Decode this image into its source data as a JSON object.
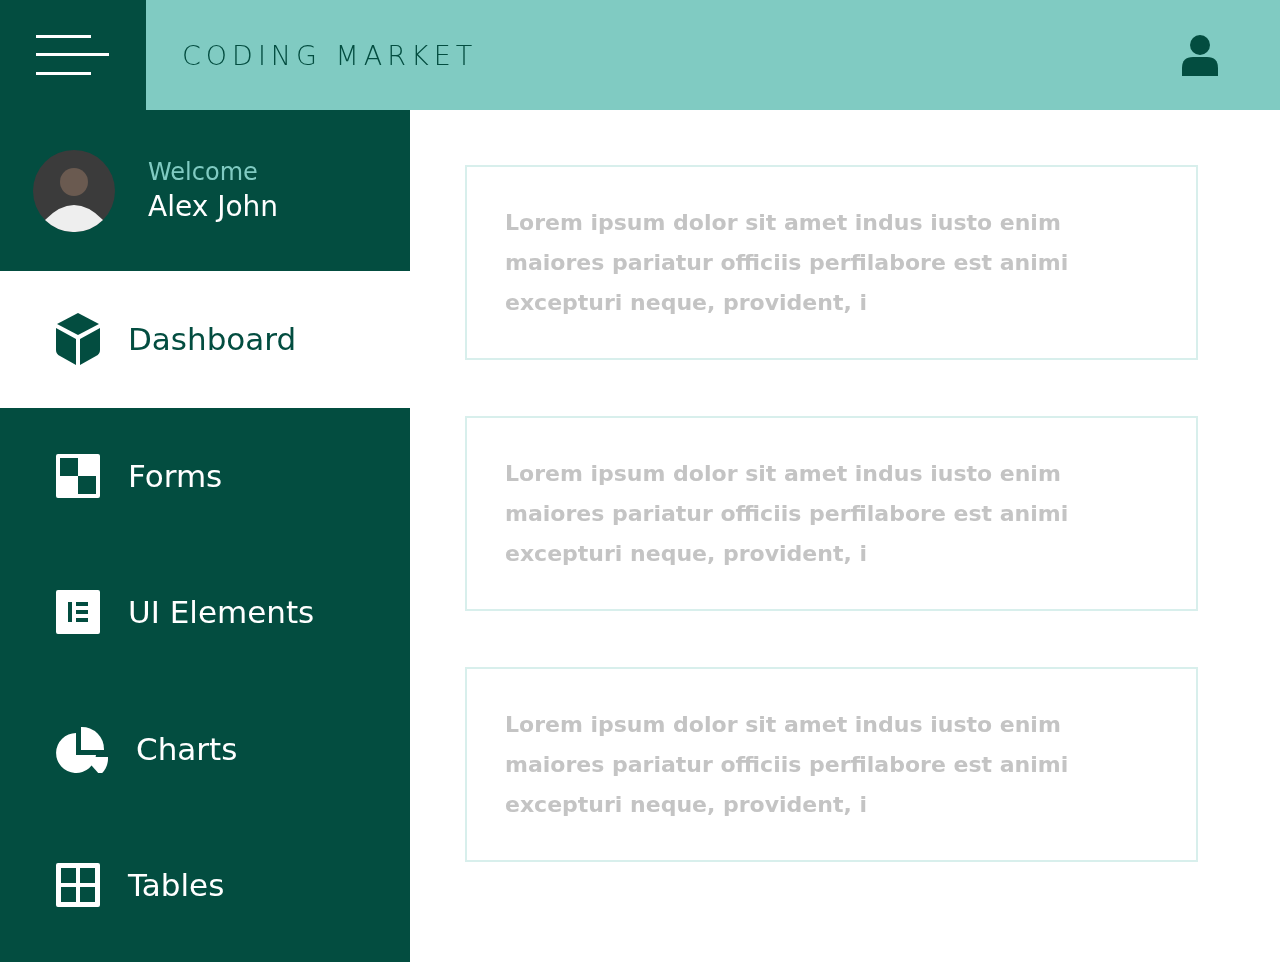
{
  "header": {
    "title": "CODING MARKET"
  },
  "profile": {
    "greeting": "Welcome",
    "name": "Alex John"
  },
  "nav": [
    {
      "label": "Dashboard",
      "kind": "cube",
      "selected": true
    },
    {
      "label": "Forms",
      "kind": "checker",
      "selected": false
    },
    {
      "label": "UI Elements",
      "kind": "elements",
      "selected": false
    },
    {
      "label": "Charts",
      "kind": "pie",
      "selected": false
    },
    {
      "label": "Tables",
      "kind": "grid",
      "selected": false
    }
  ],
  "cards": [
    {
      "text": "Lorem ipsum dolor sit amet indus iusto enim maiores pariatur officiis perfilabore est animi excepturi neque, provident, i"
    },
    {
      "text": "Lorem ipsum dolor sit amet indus iusto enim maiores pariatur officiis perfilabore est animi excepturi neque, provident, i"
    },
    {
      "text": "Lorem ipsum dolor sit amet indus iusto enim maiores pariatur officiis perfilabore est animi excepturi neque, provident, i"
    }
  ]
}
